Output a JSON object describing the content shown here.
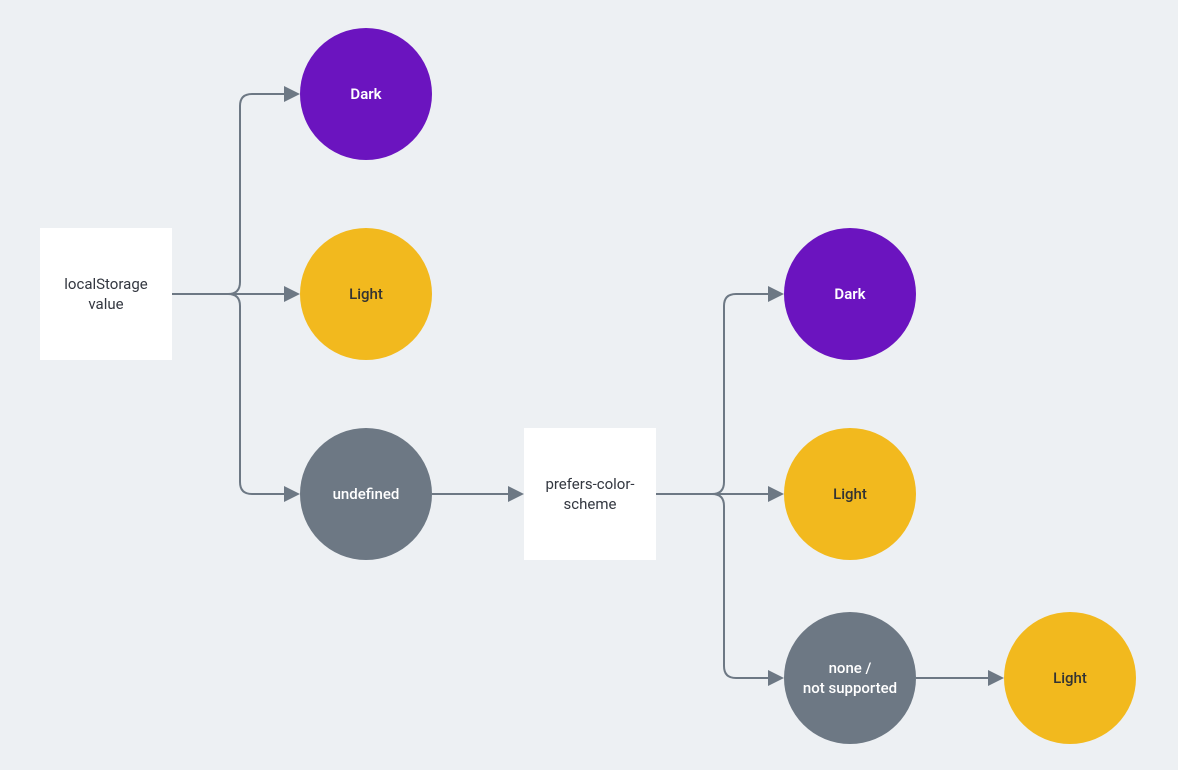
{
  "nodes": {
    "root": {
      "label": "localStorage value"
    },
    "root_dark": {
      "label": "Dark"
    },
    "root_light": {
      "label": "Light"
    },
    "root_undef": {
      "label": "undefined"
    },
    "prefers": {
      "label": "prefers-color-scheme"
    },
    "pcs_dark": {
      "label": "Dark"
    },
    "pcs_light": {
      "label": "Light"
    },
    "pcs_none": {
      "label": "none /\nnot supported"
    },
    "pcs_none_light": {
      "label": "Light"
    }
  },
  "colors": {
    "arrow": "#6d7884",
    "purple": "#6b14bf",
    "yellow": "#f2b91e",
    "gray": "#6d7884",
    "box_bg": "#ffffff",
    "page_bg": "#edf0f3"
  },
  "chart_data": {
    "type": "flow-decision-tree",
    "root": {
      "id": "localStorage value",
      "kind": "decision",
      "branches": [
        {
          "value": "Dark",
          "result": "Dark"
        },
        {
          "value": "Light",
          "result": "Light"
        },
        {
          "value": "undefined",
          "next": {
            "id": "prefers-color-scheme",
            "kind": "decision",
            "branches": [
              {
                "value": "Dark",
                "result": "Dark"
              },
              {
                "value": "Light",
                "result": "Light"
              },
              {
                "value": "none / not supported",
                "result": "Light"
              }
            ]
          }
        }
      ]
    }
  }
}
